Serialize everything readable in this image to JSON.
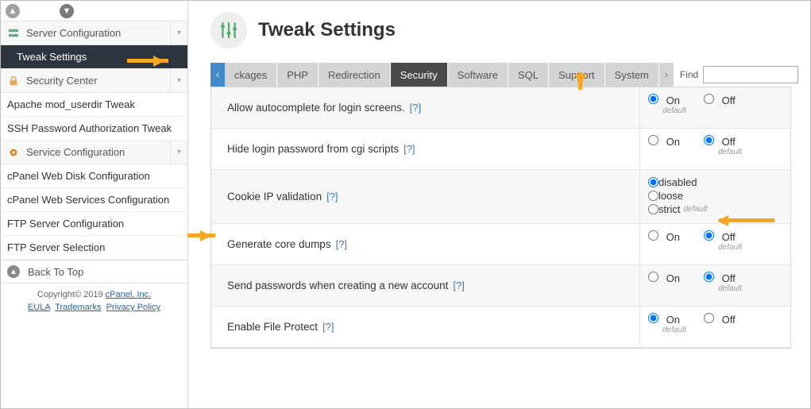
{
  "sidebar": {
    "sections": [
      {
        "icon": "server",
        "label": "Server Configuration",
        "expanded": true,
        "items": [
          {
            "label": "Tweak Settings",
            "active": true
          }
        ]
      },
      {
        "icon": "lock",
        "label": "Security Center",
        "expanded": true,
        "items": [
          {
            "label": "Apache mod_userdir Tweak"
          },
          {
            "label": "SSH Password Authorization Tweak"
          }
        ]
      },
      {
        "icon": "gear",
        "label": "Service Configuration",
        "expanded": true,
        "items": [
          {
            "label": "cPanel Web Disk Configuration"
          },
          {
            "label": "cPanel Web Services Configuration"
          },
          {
            "label": "FTP Server Configuration"
          },
          {
            "label": "FTP Server Selection"
          }
        ]
      }
    ],
    "back_top": "Back To Top",
    "copyright": "Copyright© 2019 ",
    "copyright_link": "cPanel, Inc.",
    "links": [
      "EULA",
      "Trademarks",
      "Privacy Policy"
    ]
  },
  "header": {
    "title": "Tweak Settings"
  },
  "tabs": {
    "items": [
      "ckages",
      "PHP",
      "Redirection",
      "Security",
      "Software",
      "SQL",
      "Support",
      "System"
    ],
    "active": "Security",
    "scroll_left": "‹",
    "scroll_right": "›",
    "find_label": "Find",
    "find_value": ""
  },
  "settings": [
    {
      "label": "Allow autocomplete for login screens.",
      "help": "[?]",
      "type": "onoff",
      "value": "On",
      "default": "On",
      "alt": true
    },
    {
      "label": "Hide login password from cgi scripts",
      "help": "[?]",
      "type": "onoff",
      "value": "Off",
      "default": "Off",
      "alt": false
    },
    {
      "label": "Cookie IP validation",
      "help": "[?]",
      "type": "list",
      "options": [
        "disabled",
        "loose",
        "strict"
      ],
      "value": "disabled",
      "default": "strict",
      "alt": true
    },
    {
      "label": "Generate core dumps",
      "help": "[?]",
      "type": "onoff",
      "value": "Off",
      "default": "Off",
      "alt": false
    },
    {
      "label": "Send passwords when creating a new account",
      "help": "[?]",
      "type": "onoff",
      "value": "Off",
      "default": "Off",
      "alt": true
    },
    {
      "label": "Enable File Protect",
      "help": "[?]",
      "type": "onoff",
      "value": "On",
      "default": "On",
      "alt": false
    }
  ],
  "labels": {
    "on": "On",
    "off": "Off",
    "default": "default"
  }
}
